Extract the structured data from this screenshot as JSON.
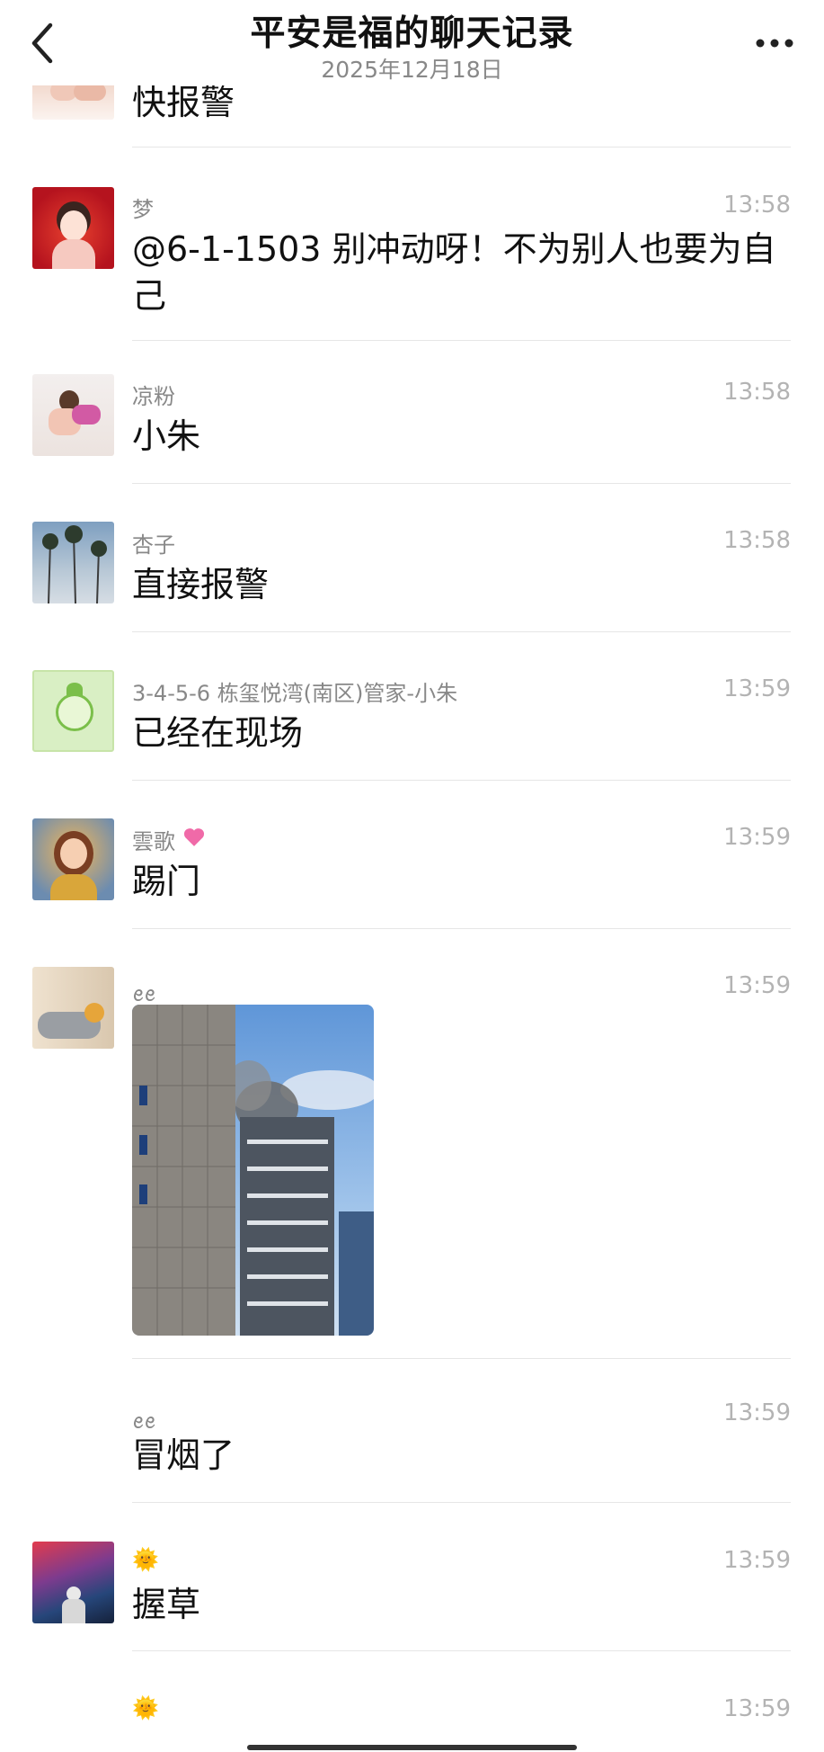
{
  "header": {
    "title": "平安是福的聊天记录",
    "date": "2025年12月18日"
  },
  "partial_top": {
    "text": "快报警"
  },
  "messages": [
    {
      "name": "梦",
      "time": "13:58",
      "text": "@6-1-1503 别冲动呀！不为别人也要为自己"
    },
    {
      "name": "凉粉",
      "time": "13:58",
      "text": "小朱"
    },
    {
      "name": "杏子",
      "time": "13:58",
      "text": "直接报警"
    },
    {
      "name": "3-4-5-6 栋玺悦湾(南区)管家-小朱",
      "time": "13:59",
      "text": "已经在现场"
    },
    {
      "name": "雲歌",
      "time": "13:59",
      "text": "踢门"
    },
    {
      "name": "ꫀꫀ",
      "time": "13:59",
      "image": "building-smoke-photo"
    },
    {
      "name": "ꫀꫀ",
      "time": "13:59",
      "text": "冒烟了"
    },
    {
      "name": "🌞",
      "time": "13:59",
      "text": "握草"
    },
    {
      "name": "🌞",
      "time": "13:59"
    }
  ],
  "colors": {
    "text": "#111111",
    "secondary": "#888888",
    "time": "#b3b3b3",
    "divider": "#e6e6e6"
  }
}
